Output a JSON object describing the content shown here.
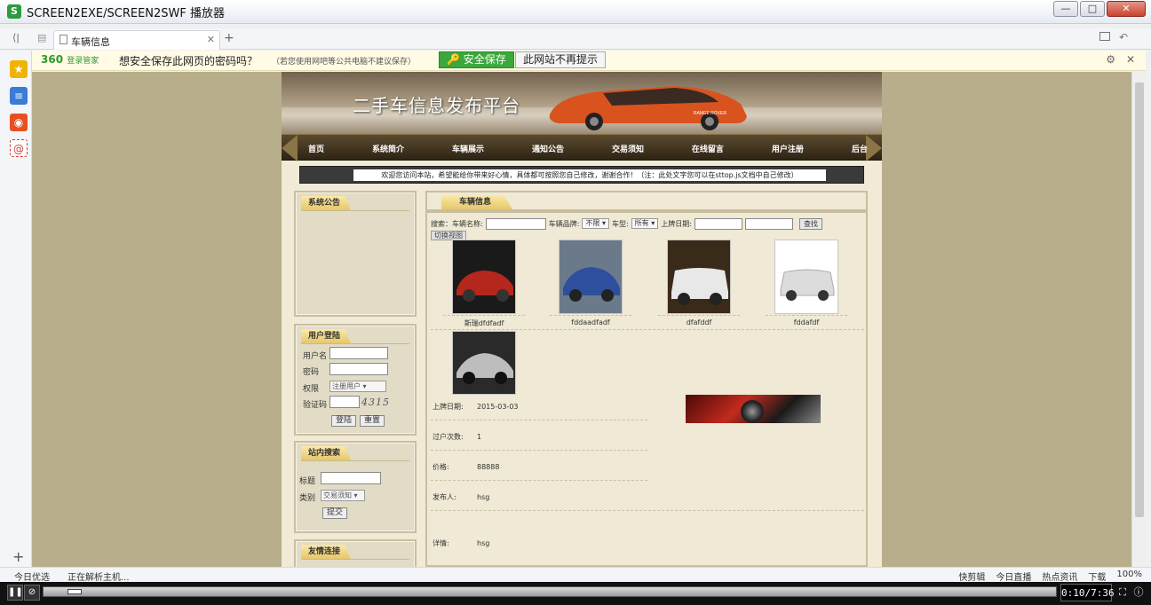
{
  "window": {
    "title": "SCREEN2EXE/SCREEN2SWF 播放器",
    "app_icon_glyph": "S",
    "buttons": {
      "minimize": "—",
      "maximize": "□",
      "close": "✕"
    }
  },
  "browser": {
    "tab_label": "车辆信息",
    "tab_close": "✕",
    "new_tab": "+",
    "back_glyph": "⟨|",
    "undo_glyph": "↶"
  },
  "password_bar": {
    "brand": "360",
    "brand_sub": "登录管家",
    "message": "想安全保存此网页的密码吗？",
    "hint": "（若您使用网吧等公共电脑不建议保存）",
    "save_label": "安全保存",
    "never_label": "此网站不再提示",
    "gear_glyph": "⚙",
    "close_glyph": "✕"
  },
  "sidebar": {
    "icons": [
      "star-icon",
      "news-icon",
      "weibo-icon",
      "mail-icon"
    ],
    "icon_colors": [
      "#f0b400",
      "#3a7bd5",
      "#e8501f",
      "#d43b3b"
    ],
    "plus_glyph": "+"
  },
  "site": {
    "title": "二手车信息发布平台",
    "car_badge": "RANGE ROVER",
    "nav": [
      "首页",
      "系统简介",
      "车辆展示",
      "通知公告",
      "交易须知",
      "在线留言",
      "用户注册",
      "后台"
    ],
    "marquee": "欢迎您访问本站，希望能给你带来好心情，具体都可按照您自己修改，谢谢合作！（注：此处文字您可以在sttop.js文档中自己修改）",
    "notice_box": {
      "title": "系统公告"
    },
    "login_box": {
      "title": "用户登陆",
      "username_label": "用户名",
      "password_label": "密码",
      "role_label": "权限",
      "role_value": "注册用户",
      "captcha_label": "验证码",
      "captcha_value": "4315",
      "login_button": "登陆",
      "reset_button": "重置"
    },
    "search_box": {
      "title": "站内搜索",
      "title_label": "标题",
      "category_label": "类别",
      "category_value": "交易须知",
      "submit_button": "提交"
    },
    "links_box": {
      "title": "友情连接"
    },
    "vehicle_panel": {
      "title": "车辆信息",
      "search_label": "搜索：",
      "name_label": "车辆名称:",
      "brand_label": "车辆品牌:",
      "brand_value": "不限",
      "type_label": "车型:",
      "type_value": "所有",
      "date_label": "上牌日期:",
      "search_button": "查找",
      "view_toggle": "切换视图",
      "cars": [
        {
          "name": "斯瑞dfdfadf",
          "color": "#b5261c",
          "bg": "#1a1a1a"
        },
        {
          "name": "fddaadfadf",
          "color": "#2d4f9e",
          "bg": "#6b7a8a"
        },
        {
          "name": "dfafddf",
          "color": "#e8e8e8",
          "bg": "#3a2a1a"
        },
        {
          "name": "fddafdf",
          "color": "#dcdcdc",
          "bg": "#ffffff"
        },
        {
          "name": "",
          "color": "#bdbdbd",
          "bg": "#2a2a2a"
        }
      ],
      "details": [
        {
          "label": "上牌日期:",
          "value": "2015-03-03"
        },
        {
          "label": "过户次数:",
          "value": "1"
        },
        {
          "label": "价格:",
          "value": "88888"
        },
        {
          "label": "发布人:",
          "value": "hsg"
        },
        {
          "label": "详情:",
          "value": "hsg"
        }
      ]
    }
  },
  "statusbar": {
    "left": "今日优选",
    "parsing": "正在解析主机...",
    "right": [
      "快剪辑",
      "今日直播",
      "热点资讯",
      "下载",
      "100%"
    ]
  },
  "player": {
    "time": "0:10/7:36",
    "progress": 0.022,
    "pause_glyph": "❚❚",
    "stop_glyph": "⊘",
    "fullscreen_glyph": "⛶",
    "info_glyph": "ⓘ"
  }
}
